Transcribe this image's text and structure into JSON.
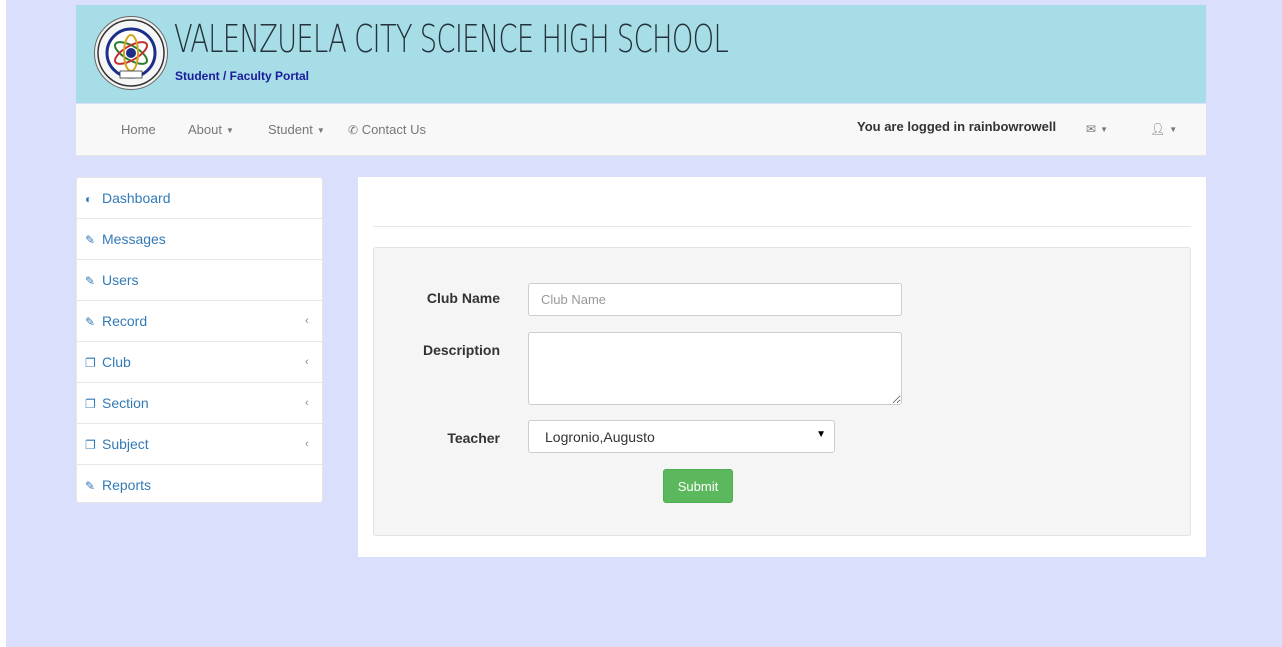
{
  "header": {
    "title": "VALENZUELA CITY SCIENCE HIGH SCHOOL",
    "subtitle": "Student / Faculty Portal",
    "logo_icon": "school-seal-logo"
  },
  "navbar": {
    "items": [
      {
        "label": "Home",
        "has_dropdown": false
      },
      {
        "label": "About",
        "has_dropdown": true
      },
      {
        "label": "Student",
        "has_dropdown": true
      },
      {
        "label": "Contact Us",
        "icon": "phone-icon"
      }
    ],
    "logged_in_text": "You are logged in rainbowrowell",
    "messages_icon": "envelope-icon",
    "user_icon": "user-icon"
  },
  "sidebar": {
    "items": [
      {
        "label": "Dashboard",
        "icon": "dashboard-icon",
        "has_submenu": false
      },
      {
        "label": "Messages",
        "icon": "edit-icon",
        "has_submenu": false
      },
      {
        "label": "Users",
        "icon": "edit-icon",
        "has_submenu": false
      },
      {
        "label": "Record",
        "icon": "edit-icon",
        "has_submenu": true
      },
      {
        "label": "Club",
        "icon": "copy-icon",
        "has_submenu": true
      },
      {
        "label": "Section",
        "icon": "copy-icon",
        "has_submenu": true
      },
      {
        "label": "Subject",
        "icon": "copy-icon",
        "has_submenu": true
      },
      {
        "label": "Reports",
        "icon": "edit-icon",
        "has_submenu": false
      }
    ]
  },
  "form": {
    "club_name_label": "Club Name",
    "club_name_value": "",
    "club_name_placeholder": "Club Name",
    "description_label": "Description",
    "description_value": "",
    "teacher_label": "Teacher",
    "teacher_selected": "Logronio,Augusto",
    "submit_label": "Submit"
  },
  "colors": {
    "page_bg": "#dadffb",
    "header_bg": "#a6dde6",
    "link": "#337ab7",
    "submit": "#5cb85c",
    "subtitle": "#1b1b9c"
  }
}
